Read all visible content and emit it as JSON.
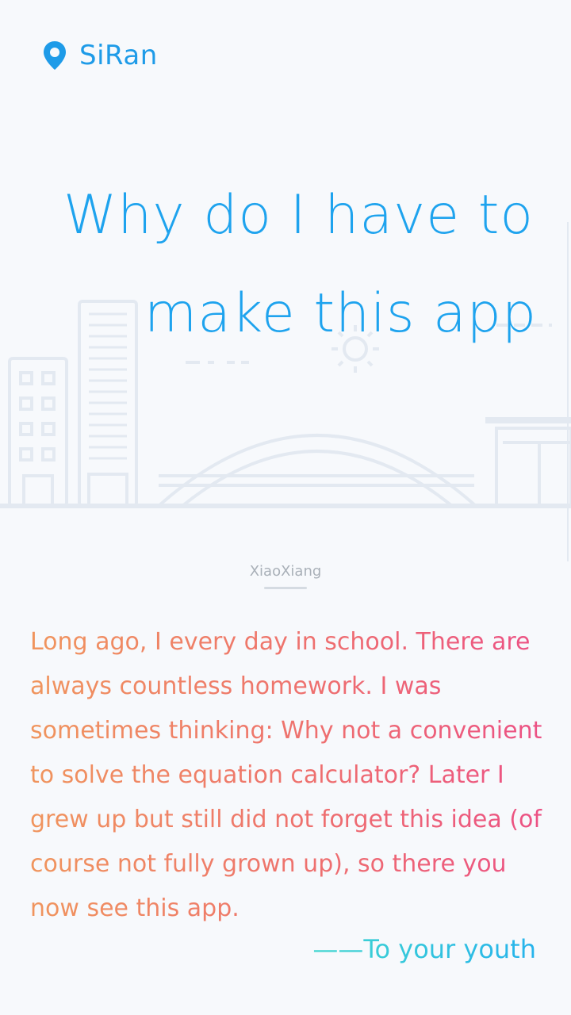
{
  "header": {
    "location_icon": "location-pin-icon",
    "name": "SiRan"
  },
  "hero": {
    "title_line1": "Why do I have to",
    "title_line2": "make this app",
    "illustration": "city-skyline-with-bridge-and-sun"
  },
  "author": "XiaoXiang",
  "story": "Long ago, I every day in school. There are always countless homework. I was sometimes thinking: Why not a convenient to solve the equation calculator? Later I grew up but still did not forget this idea (of course not fully grown up), so there you now see this app.",
  "signature": "——To your youth",
  "colors": {
    "accent": "#1ea3ee",
    "story_gradient_start": "#f0955d",
    "story_gradient_end": "#ec4f86",
    "signature_gradient_start": "#40d6d0",
    "signature_gradient_end": "#26b3ec"
  }
}
